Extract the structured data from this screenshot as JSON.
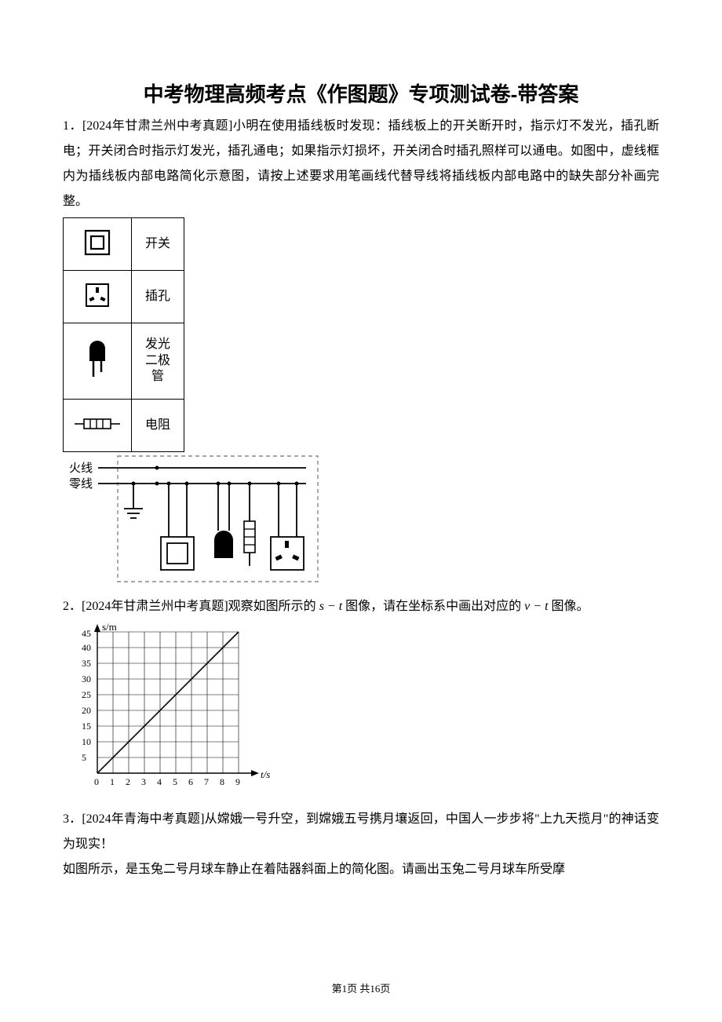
{
  "title": "中考物理高频考点《作图题》专项测试卷-带答案",
  "q1": {
    "prefix": "1．[2024年甘肃兰州中考真题]",
    "text": "小明在使用插线板时发现：插线板上的开关断开时，指示灯不发光，插孔断电；开关闭合时指示灯发光，插孔通电；如果指示灯损坏，开关闭合时插孔照样可以通电。如图中，虚线框内为插线板内部电路简化示意图，请按上述要求用笔画线代替导线将插线板内部电路中的缺失部分补画完整。",
    "legend": {
      "switch": "开关",
      "socket": "插孔",
      "led": "发光二极管",
      "resistor": "电阻"
    },
    "circuit": {
      "live": "火线",
      "neutral": "零线"
    }
  },
  "q2": {
    "prefix": "2．[2024年甘肃兰州中考真题]",
    "text_a": "观察如图所示的 ",
    "text_b": " 图像，请在坐标系中画出对应的 ",
    "text_c": " 图像。"
  },
  "chart_data": {
    "type": "line",
    "title": "",
    "xlabel": "t/s",
    "ylabel": "s/m",
    "x": [
      0,
      1,
      2,
      3,
      4,
      5,
      6,
      7,
      8,
      9
    ],
    "y": [
      0,
      5,
      10,
      15,
      20,
      25,
      30,
      35,
      40,
      45
    ],
    "xlim": [
      0,
      9
    ],
    "ylim": [
      0,
      45
    ],
    "xtick_labels": [
      "0",
      "1",
      "2",
      "3",
      "4",
      "5",
      "6",
      "7",
      "8",
      "9"
    ],
    "ytick_labels": [
      "5",
      "10",
      "15",
      "20",
      "25",
      "30",
      "35",
      "40",
      "45"
    ]
  },
  "q3": {
    "prefix": "3．[2024年青海中考真题]",
    "text_a": "从嫦娥一号升空，到嫦娥五号携月壤返回，中国人一步步将\"上九天揽月\"的神话变为现实！",
    "text_b": "如图所示，是玉兔二号月球车静止在着陆器斜面上的简化图。请画出玉兔二号月球车所受摩"
  },
  "footer": {
    "page_current": "1",
    "page_total": "16",
    "prefix": "第",
    "mid": "页 共",
    "suffix": "页"
  }
}
